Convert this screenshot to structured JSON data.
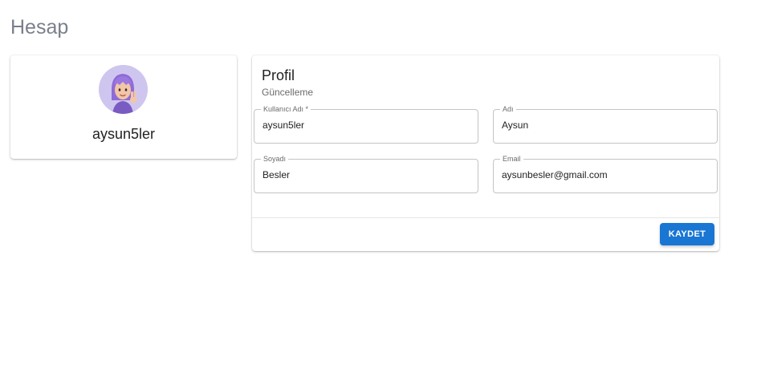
{
  "page": {
    "title": "Hesap"
  },
  "user_card": {
    "username": "aysun5ler",
    "avatar_icon": "memoji-avatar-icon"
  },
  "profile": {
    "title": "Profil",
    "subtitle": "Güncelleme",
    "fields": {
      "username": {
        "label": "Kullanıcı Adı *",
        "value": "aysun5ler"
      },
      "name": {
        "label": "Adı",
        "value": "Aysun"
      },
      "surname": {
        "label": "Soyadı",
        "value": "Besler"
      },
      "email": {
        "label": "Email",
        "value": "aysunbesler@gmail.com"
      }
    },
    "save_label": "KAYDET"
  },
  "colors": {
    "accent": "#1976d2",
    "title_gray": "#7a7f8c",
    "avatar_bg": "#cfc6ef"
  }
}
